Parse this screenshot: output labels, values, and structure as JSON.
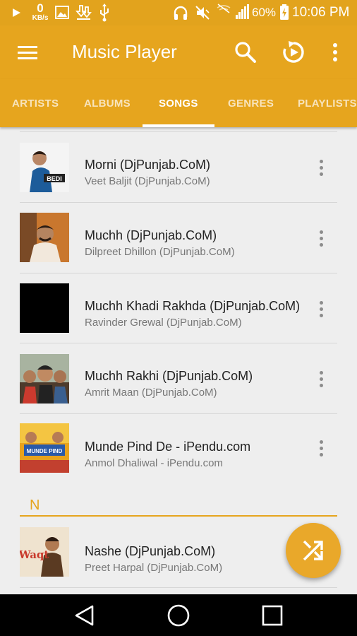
{
  "status_bar": {
    "net_speed_value": "0",
    "net_speed_unit": "KB/s",
    "battery_percent": "60%",
    "time": "10:06 PM"
  },
  "app_bar": {
    "title": "Music Player",
    "icons": [
      "menu-icon",
      "search-icon",
      "replay-icon",
      "more-vert-icon"
    ]
  },
  "tabs": [
    {
      "label": "ARTISTS",
      "active": false
    },
    {
      "label": "ALBUMS",
      "active": false
    },
    {
      "label": "SONGS",
      "active": true
    },
    {
      "label": "GENRES",
      "active": false
    },
    {
      "label": "PLAYLISTS",
      "active": false
    }
  ],
  "songs": [
    {
      "title": "Morni (DjPunjab.CoM)",
      "artist": "Veet Baljit (DjPunjab.CoM)"
    },
    {
      "title": "Muchh (DjPunjab.CoM)",
      "artist": "Dilpreet Dhillon (DjPunjab.CoM)"
    },
    {
      "title": "Muchh Khadi Rakhda (DjPunjab.CoM)",
      "artist": "Ravinder Grewal (DjPunjab.CoM)"
    },
    {
      "title": "Muchh Rakhi (DjPunjab.CoM)",
      "artist": "Amrit Maan (DjPunjab.CoM)"
    },
    {
      "title": "Munde Pind De - iPendu.com",
      "artist": "Anmol Dhaliwal - iPendu.com"
    }
  ],
  "section_n": {
    "letter": "N",
    "songs": [
      {
        "title": "Nashe (DjPunjab.CoM)",
        "artist": "Preet Harpal (DjPunjab.CoM)"
      }
    ]
  },
  "art_text": {
    "bedi": "BEDI",
    "munde_pind": "MUNDE PIND",
    "waqt": "Waqt"
  },
  "fab": {
    "icon": "shuffle-icon"
  },
  "colors": {
    "accent": "#e6a51e",
    "list_bg": "#eeeeee"
  }
}
